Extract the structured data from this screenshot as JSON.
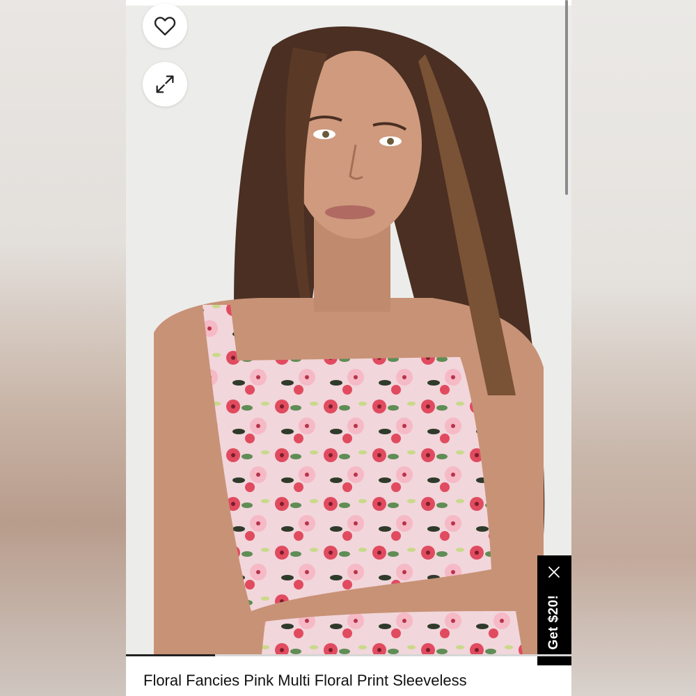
{
  "actions": {
    "favorite_icon": "heart-outline-icon",
    "expand_icon": "expand-arrows-icon"
  },
  "gallery": {
    "progress_fraction": 0.2
  },
  "promo": {
    "label": "Get $20!",
    "close_icon": "close-icon"
  },
  "product": {
    "title": "Floral Fancies Pink Multi Floral Print Sleeveless"
  },
  "colors": {
    "promo_background": "#000000",
    "accent_pink": "#e14b5f"
  }
}
